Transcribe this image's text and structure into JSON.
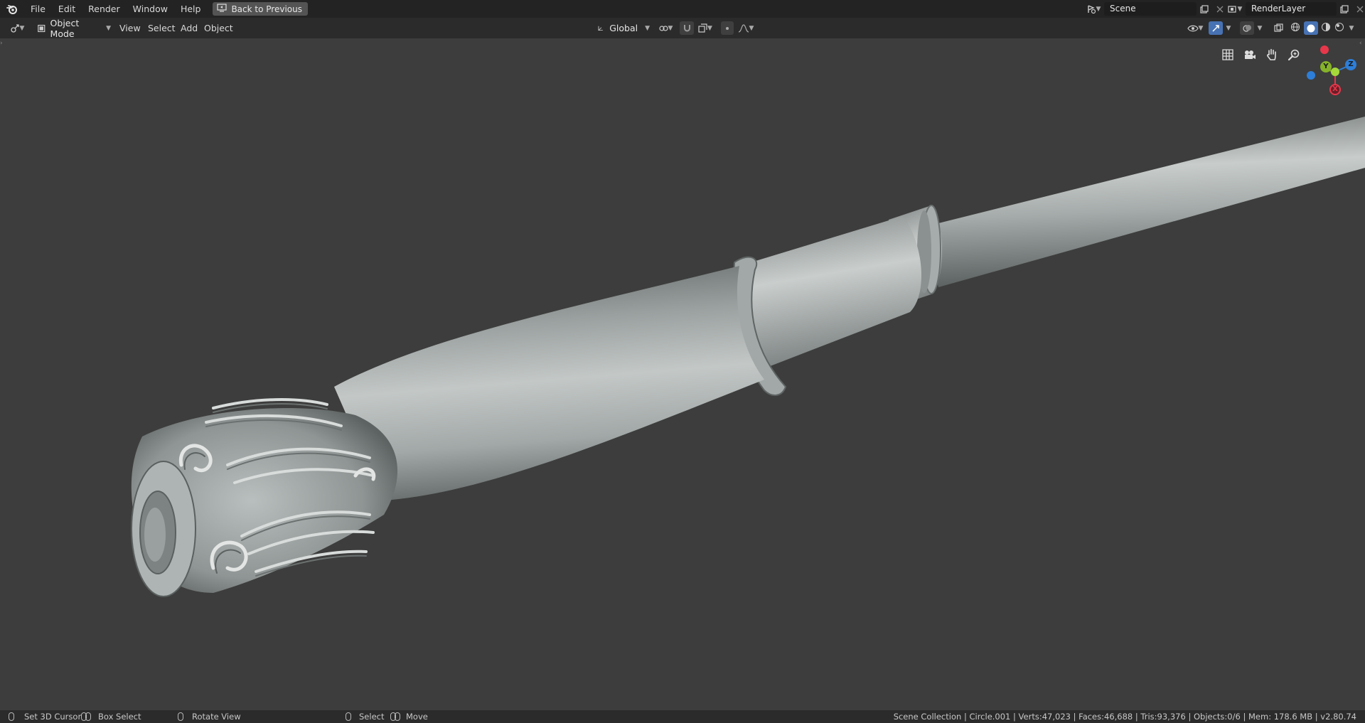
{
  "menu": {
    "items": [
      "File",
      "Edit",
      "Render",
      "Window",
      "Help"
    ],
    "back_button": "Back to Previous"
  },
  "topbar_right": {
    "scene_name": "Scene",
    "render_layer": "RenderLayer"
  },
  "header": {
    "mode": "Object Mode",
    "menus": [
      "View",
      "Select",
      "Add",
      "Object"
    ],
    "transform_orientation": "Global"
  },
  "statusbar": {
    "hints": {
      "set_cursor": "Set 3D Cursor",
      "box_select": "Box Select",
      "rotate_view": "Rotate View",
      "select": "Select",
      "move": "Move"
    },
    "info": "Scene Collection | Circle.001 | Verts:47,023 | Faces:46,688 | Tris:93,376 | Objects:0/6 | Mem: 178.6 MB | v2.80.74"
  },
  "gizmo": {
    "axis_x": "X",
    "axis_y": "Y",
    "axis_z": "Z",
    "color_x": "#e8374a",
    "color_y": "#86b22a",
    "color_z": "#2d7ed8"
  },
  "icons": {
    "logo": "blender-logo-icon",
    "grid": "grid-icon",
    "camera": "camera-icon",
    "hand": "pan-hand-icon",
    "zoom": "zoom-icon"
  }
}
